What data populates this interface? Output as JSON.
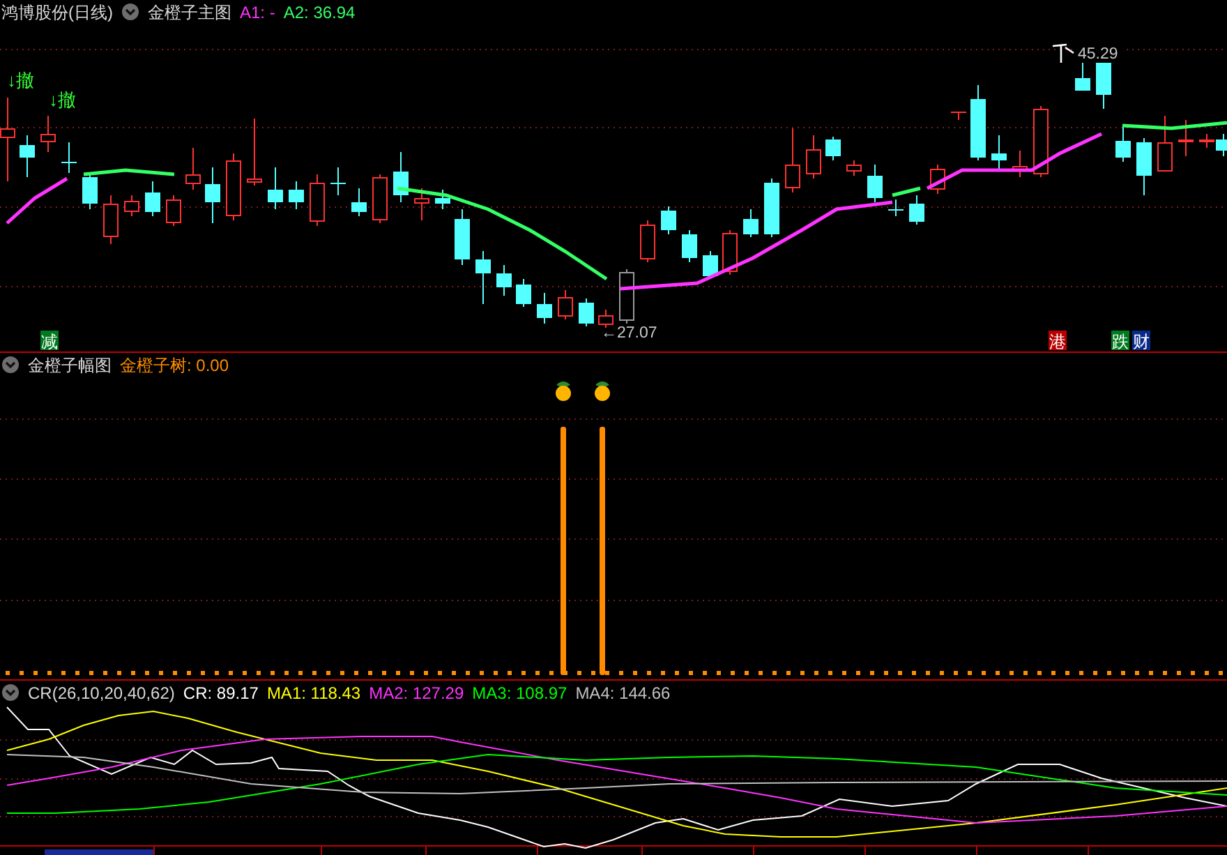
{
  "main_panel": {
    "stock": "鸿博股份(日线)",
    "indicator": "金橙子主图",
    "values": [
      {
        "label": "A1:",
        "value": "-",
        "color": "#ff33ff"
      },
      {
        "label": "A2:",
        "value": "36.94",
        "color": "#33ff66"
      }
    ],
    "signals": [
      {
        "text": "↓撤"
      },
      {
        "text": "↓撤"
      }
    ],
    "tags": [
      {
        "text": "减",
        "color": "#007a1f"
      },
      {
        "text": "港",
        "color": "#b80000"
      },
      {
        "text": "跌",
        "color": "#007a1f"
      },
      {
        "text": "财",
        "color": "#0a2a8a"
      }
    ],
    "high_label": "45.29",
    "low_label": "←27.07"
  },
  "amplitude_panel": {
    "indicator": "金橙子幅图",
    "values": [
      {
        "label": "金橙子树:",
        "value": "0.00",
        "color": "#ff8c00"
      }
    ]
  },
  "cr_panel": {
    "indicator": "CR(26,10,20,40,62)",
    "values": [
      {
        "label": "CR:",
        "value": "89.17",
        "color": "#ffffff"
      },
      {
        "label": "MA1:",
        "value": "118.43",
        "color": "#ffff00"
      },
      {
        "label": "MA2:",
        "value": "127.29",
        "color": "#ff33ff"
      },
      {
        "label": "MA3:",
        "value": "108.97",
        "color": "#00ff00"
      },
      {
        "label": "MA4:",
        "value": "144.66",
        "color": "#c0c0c0"
      }
    ]
  }
}
